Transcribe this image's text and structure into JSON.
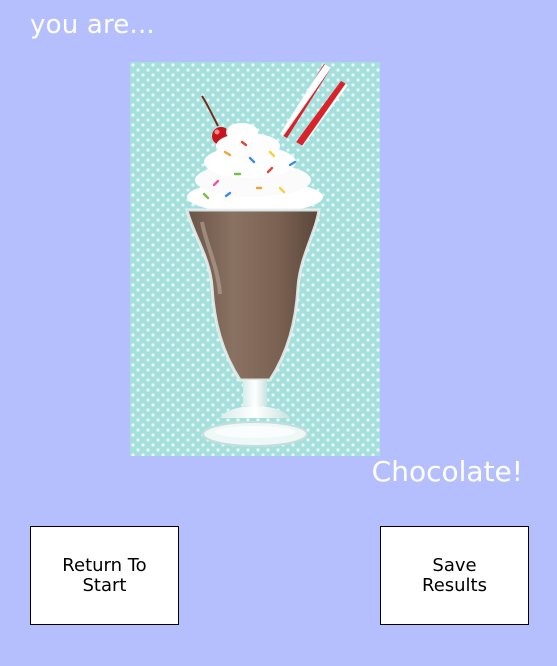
{
  "heading": "you are...",
  "result_name": "Chocolate!",
  "image": {
    "subject": "chocolate milkshake in a sundae glass with whipped cream, sprinkles, a cherry and red-and-white striped straws",
    "background_color": "#a6e0dc",
    "dot_color": "#e9f7f6"
  },
  "buttons": {
    "return_label": "Return To Start",
    "save_label": "Save Results"
  }
}
